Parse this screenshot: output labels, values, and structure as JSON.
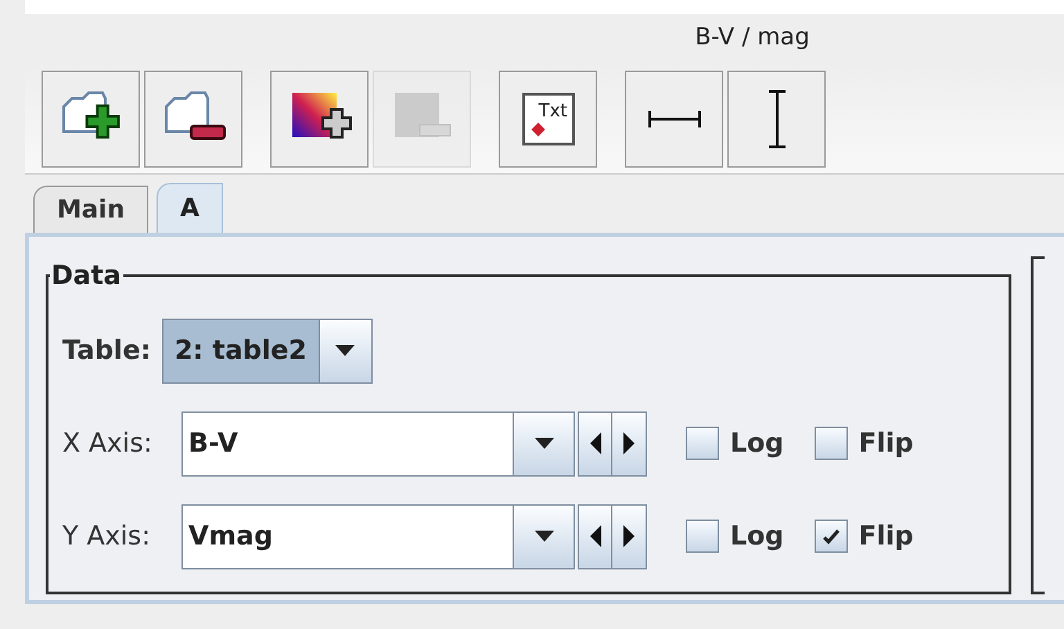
{
  "chart": {
    "axis_label": "B-V / mag"
  },
  "toolbar": [
    {
      "kind": "add-layer",
      "disabled": false
    },
    {
      "kind": "remove-layer",
      "disabled": false
    },
    {
      "kind": "add-aux",
      "disabled": false
    },
    {
      "kind": "remove-aux",
      "disabled": true
    },
    {
      "kind": "text",
      "label": "Txt",
      "disabled": false
    },
    {
      "kind": "hbar",
      "disabled": false
    },
    {
      "kind": "vbar",
      "disabled": false
    }
  ],
  "tabs": [
    {
      "label": "Main",
      "selected": false
    },
    {
      "label": "A",
      "selected": true
    }
  ],
  "data_group": {
    "title": "Data",
    "table_label": "Table:",
    "table_value": "2: table2",
    "axes": [
      {
        "label": "X Axis:",
        "value": "B-V",
        "log_label": "Log",
        "log": false,
        "flip_label": "Flip",
        "flip": false
      },
      {
        "label": "Y Axis:",
        "value": "Vmag",
        "log_label": "Log",
        "log": false,
        "flip_label": "Flip",
        "flip": true
      }
    ]
  }
}
